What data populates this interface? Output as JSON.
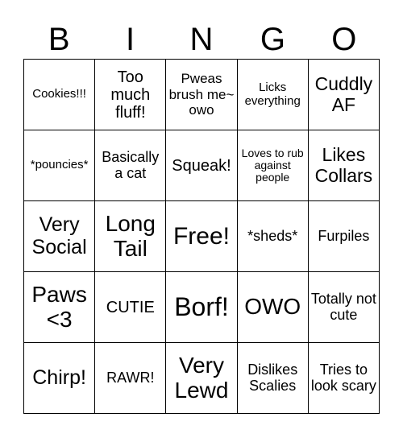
{
  "header": {
    "letters": [
      "B",
      "I",
      "N",
      "G",
      "O"
    ]
  },
  "cells": [
    [
      "Cookies!!!",
      "Too much fluff!",
      "Pweas brush me~ owo",
      "Licks everything",
      "Cuddly AF"
    ],
    [
      "*pouncies*",
      "Basically a cat",
      "Squeak!",
      "Loves to rub against people",
      "Likes Collars"
    ],
    [
      "Very Social",
      "Long Tail",
      "Free!",
      "*sheds*",
      "Furpiles"
    ],
    [
      "Paws <3",
      "CUTIE",
      "Borf!",
      "OWO",
      "Totally not cute"
    ],
    [
      "Chirp!",
      "RAWR!",
      "Very Lewd",
      "Dislikes Scalies",
      "Tries to look scary"
    ]
  ]
}
